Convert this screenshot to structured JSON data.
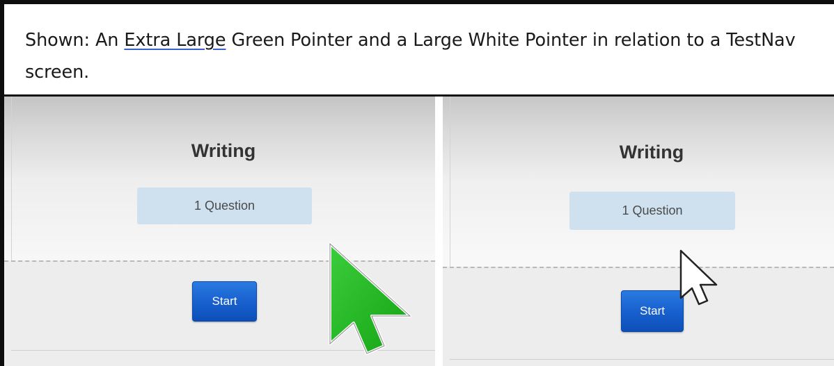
{
  "caption": {
    "prefix": "Shown: An ",
    "underlined": "Extra Large",
    "suffix": " Green Pointer and a Large White Pointer in relation to a TestNav screen."
  },
  "screens": [
    {
      "pointer": "extra-large-green-pointer-icon",
      "title": "Writing",
      "question_count": "1 Question",
      "start_label": "Start"
    },
    {
      "pointer": "large-white-pointer-icon",
      "title": "Writing",
      "question_count": "1 Question",
      "start_label": "Start"
    }
  ],
  "colors": {
    "green_pointer": "#1fb51f",
    "white_pointer": "#ffffff",
    "start_button": "#1861cf",
    "question_badge": "#cfe1ef"
  }
}
